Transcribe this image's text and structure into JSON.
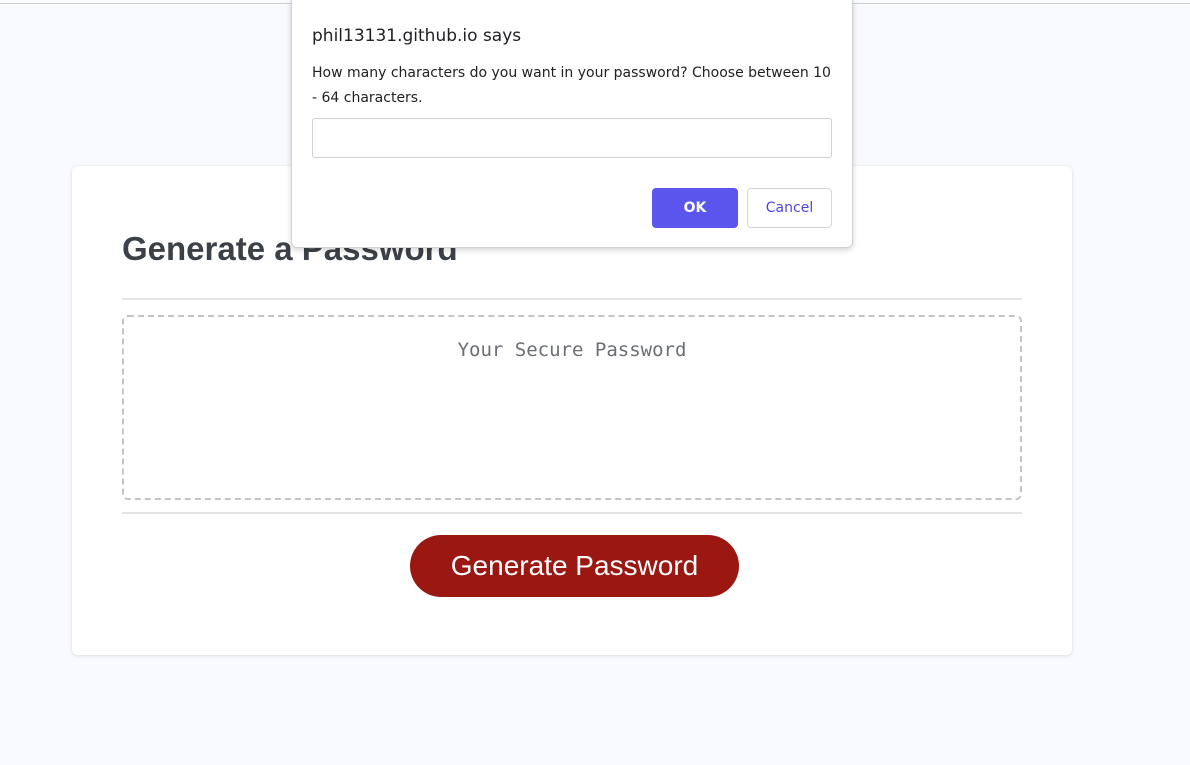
{
  "card": {
    "title": "Generate a Password",
    "password_placeholder": "Your Secure Password",
    "generate_button_label": "Generate Password"
  },
  "dialog": {
    "origin": "phil13131.github.io says",
    "message": "How many characters do you want in your password? Choose between 10 - 64 characters.",
    "input_value": "",
    "ok_label": "OK",
    "cancel_label": "Cancel"
  },
  "colors": {
    "page_background": "#f9fafe",
    "generate_button": "#9b1711",
    "dialog_ok_button": "#5b55ee",
    "dialog_cancel_text": "#4e48d8",
    "title_text": "#3c4147"
  }
}
